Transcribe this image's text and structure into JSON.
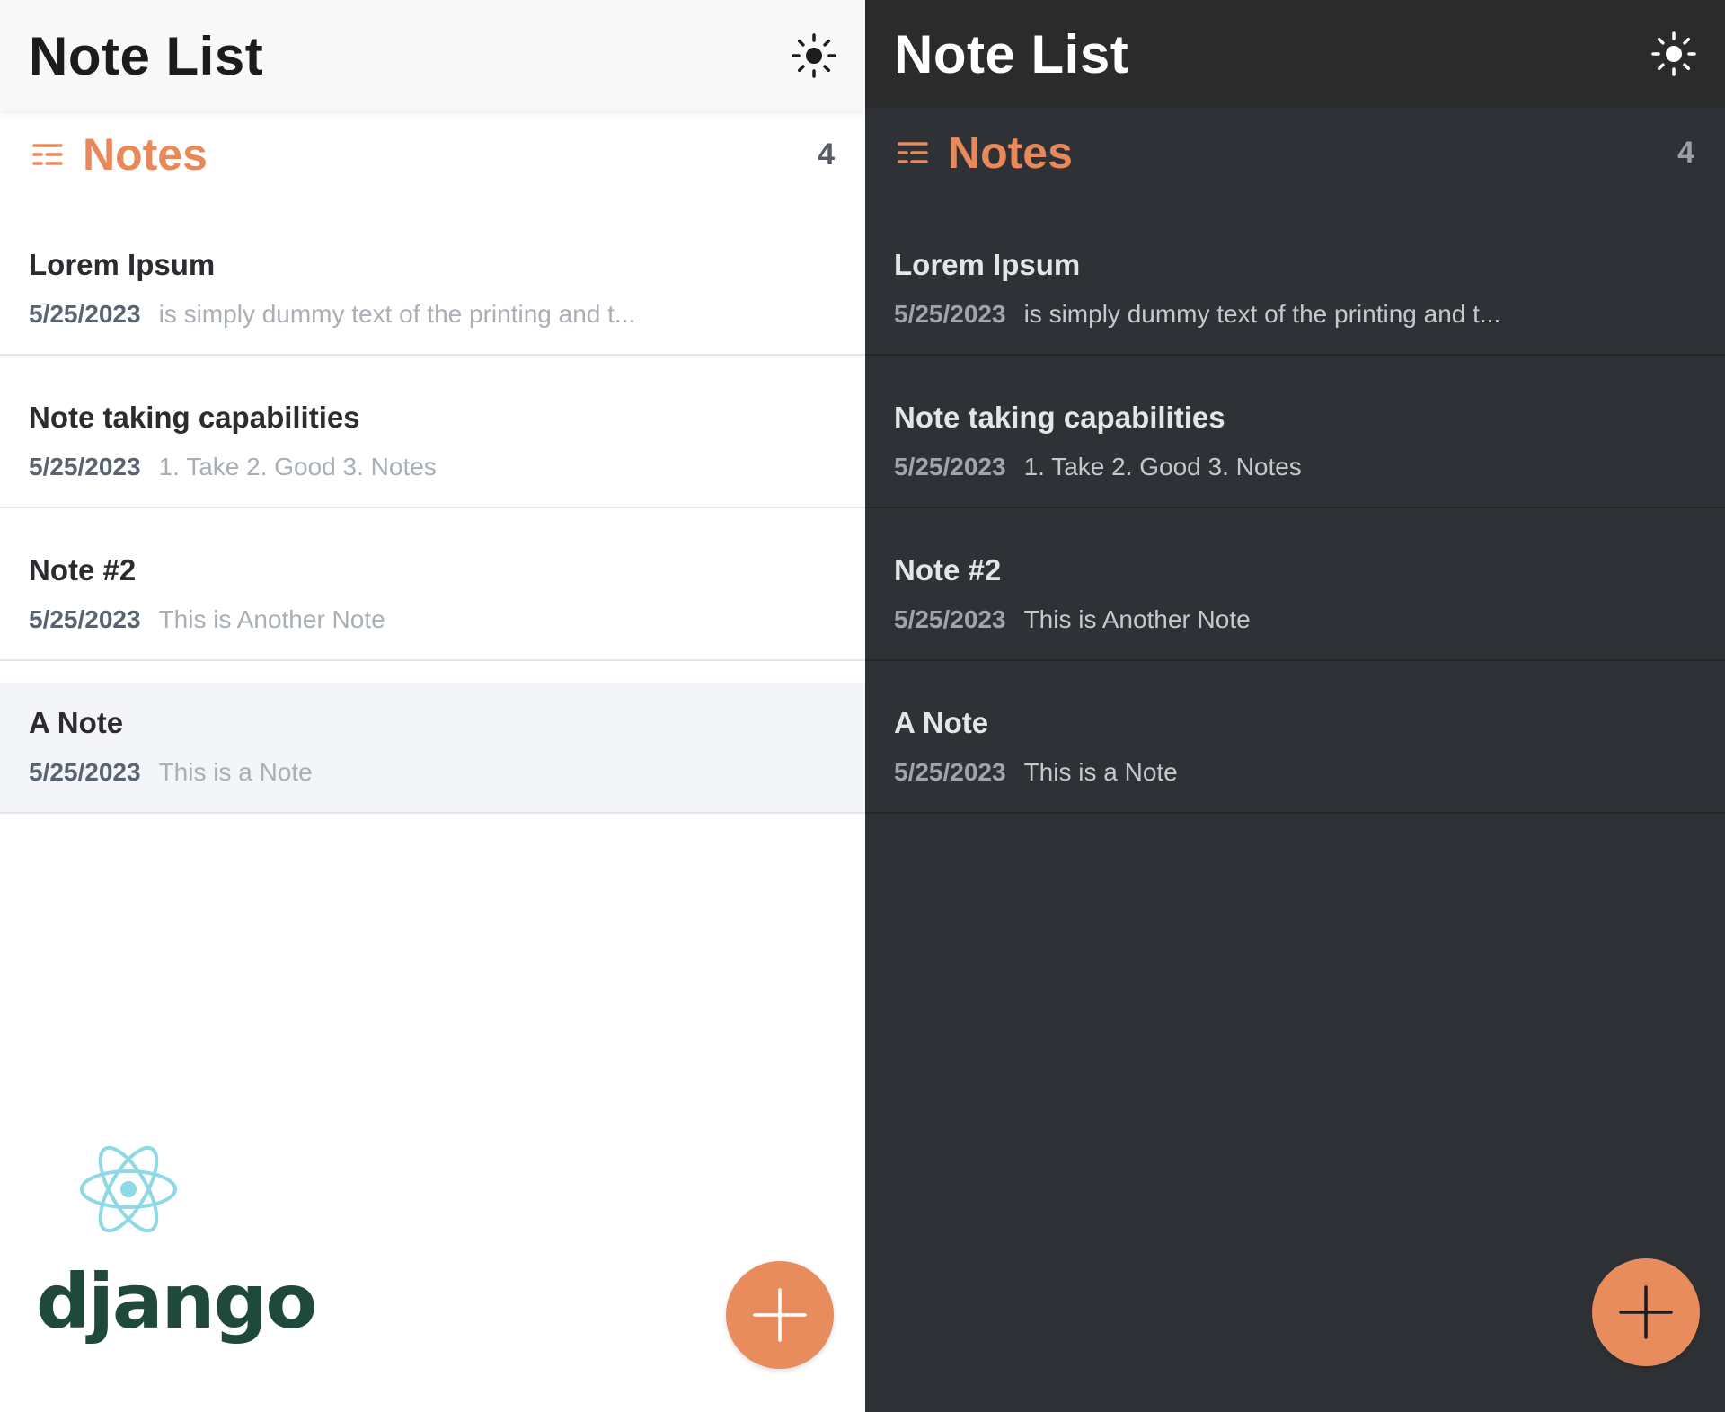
{
  "light": {
    "header": {
      "title": "Note List",
      "theme_icon": "sun-icon"
    },
    "notes_section": {
      "title": "Notes",
      "count": "4",
      "icon": "list-icon"
    },
    "notes": [
      {
        "title": "Lorem Ipsum",
        "date": "5/25/2023",
        "preview": "is simply dummy text of the printing and t..."
      },
      {
        "title": "Note taking capabilities",
        "date": "5/25/2023",
        "preview": "1. Take 2. Good 3. Notes"
      },
      {
        "title": "Note #2",
        "date": "5/25/2023",
        "preview": "This is Another Note"
      },
      {
        "title": "A Note",
        "date": "5/25/2023",
        "preview": "This is a Note"
      }
    ],
    "fab_icon": "plus-icon",
    "logos": {
      "react_icon": "react-logo-icon",
      "django_text": "django"
    }
  },
  "dark": {
    "header": {
      "title": "Note List",
      "theme_icon": "sun-icon"
    },
    "notes_section": {
      "title": "Notes",
      "count": "4",
      "icon": "list-icon"
    },
    "notes": [
      {
        "title": "Lorem Ipsum",
        "date": "5/25/2023",
        "preview": "is simply dummy text of the printing and t..."
      },
      {
        "title": "Note taking capabilities",
        "date": "5/25/2023",
        "preview": "1. Take 2. Good 3. Notes"
      },
      {
        "title": "Note #2",
        "date": "5/25/2023",
        "preview": "This is Another Note"
      },
      {
        "title": "A Note",
        "date": "5/25/2023",
        "preview": "This is a Note"
      }
    ],
    "fab_icon": "plus-icon"
  },
  "colors": {
    "accent": "#e8895b",
    "light_bg": "#ffffff",
    "dark_bg": "#2e3135",
    "react": "#8fd8e6",
    "django": "#1f4a3a"
  }
}
